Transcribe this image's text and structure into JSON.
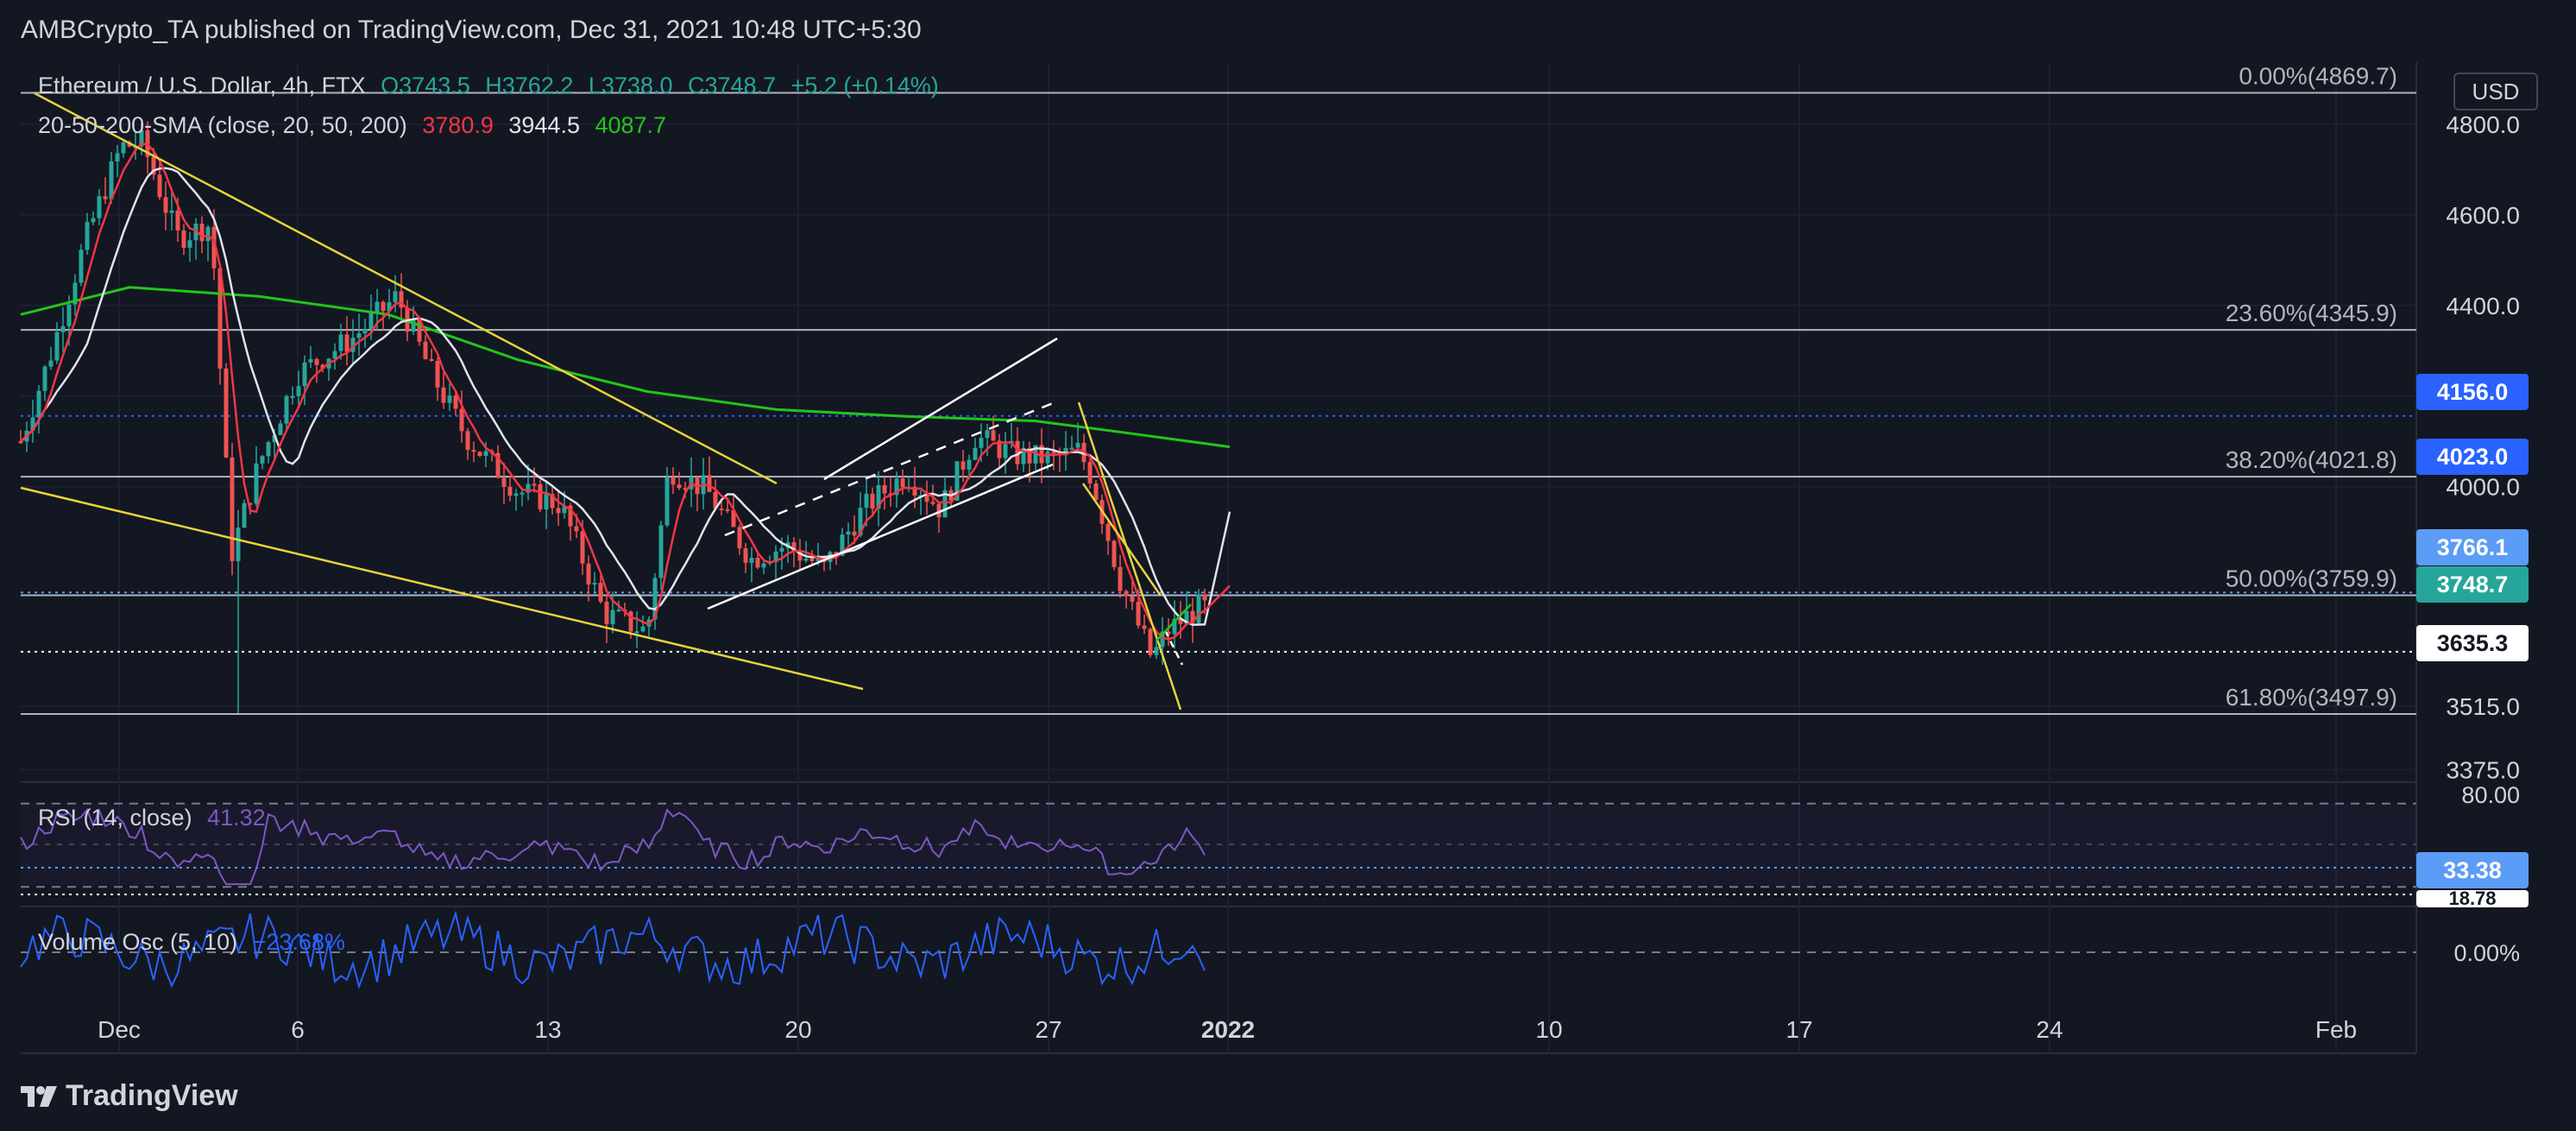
{
  "header": {
    "published": "AMBCrypto_TA published on TradingView.com, Dec 31, 2021 10:48 UTC+5:30"
  },
  "legend": {
    "symbol": "Ethereum / U.S. Dollar, 4h, FTX",
    "ohlc": {
      "o": "O3743.5",
      "h": "H3762.2",
      "l": "L3738.0",
      "c": "C3748.7",
      "chg": "+5.2 (+0.14%)"
    },
    "sma_label": "20-50-200-SMA (close, 20, 50, 200)",
    "sma_values": [
      "3780.9",
      "3944.5",
      "4087.7"
    ],
    "rsi_label": "RSI (14, close)",
    "rsi_value": "41.32",
    "vol_label": "Volume Osc (5, 10)",
    "vol_value": "−23.68%"
  },
  "axis": {
    "currency": "USD"
  },
  "price_tags": [
    {
      "label": "4156.0",
      "bg": "#2962ff",
      "fg": "#ffffff"
    },
    {
      "label": "4023.0",
      "bg": "#2962ff",
      "fg": "#ffffff"
    },
    {
      "label": "3766.1",
      "bg": "#5b9cf6",
      "fg": "#ffffff"
    },
    {
      "label": "3748.7",
      "bg": "#26a69a",
      "fg": "#ffffff"
    },
    {
      "label": "3635.3",
      "bg": "#ffffff",
      "fg": "#131722"
    },
    {
      "label": "33.38",
      "bg": "#5b9cf6",
      "fg": "#ffffff"
    },
    {
      "label": "18.78",
      "bg": "#ffffff",
      "fg": "#131722"
    }
  ],
  "footer": {
    "brand": "TradingView"
  },
  "colors": {
    "up": "#26a69a",
    "down": "#ef5350",
    "sma20": "#f23645",
    "sma50": "#e0e3eb",
    "sma200": "#22c51a",
    "fib": "#b2b5be",
    "trend": "#e8d33b",
    "channel": "#ffffff",
    "rsi": "#7e57c2",
    "vol": "#2962ff"
  },
  "chart_data": {
    "type": "candlestick",
    "title": "Ethereum / U.S. Dollar, 4h, FTX",
    "ylim": [
      3375,
      4900
    ],
    "y_ticks": [
      "4800.0",
      "4600.0",
      "4400.0",
      "4200.0",
      "4000.0",
      "3515.0",
      "3375.0"
    ],
    "x_ticks": [
      "Dec",
      "6",
      "13",
      "20",
      "27",
      "2022",
      "10",
      "17",
      "24",
      "Feb"
    ],
    "fib_levels": [
      {
        "label": "0.00%(4869.7)",
        "value": 4869.7
      },
      {
        "label": "23.60%(4345.9)",
        "value": 4345.9
      },
      {
        "label": "38.20%(4021.8)",
        "value": 4021.8
      },
      {
        "label": "50.00%(3759.9)",
        "value": 3759.9
      },
      {
        "label": "61.80%(3497.9)",
        "value": 3497.9
      }
    ],
    "horizontal_levels": [
      4156.0,
      3766.1,
      3635.3
    ],
    "sma_last": {
      "sma20": 3780.9,
      "sma50": 3944.5,
      "sma200": 4087.7
    },
    "last_close": 3748.7,
    "rsi": {
      "upper": 80,
      "lower": 20,
      "last": 41.32,
      "ticks": [
        "80.00",
        "33.38",
        "18.78"
      ]
    },
    "volume_osc": {
      "last": -23.68,
      "ticks": [
        "0.00%"
      ]
    }
  }
}
